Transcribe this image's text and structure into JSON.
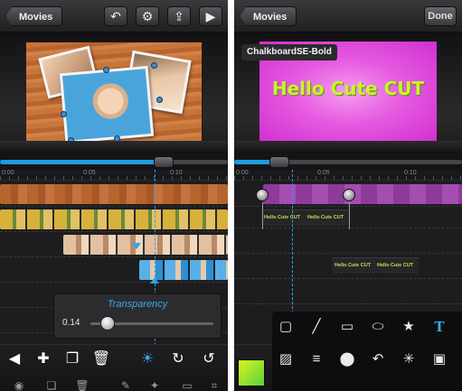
{
  "left": {
    "topbar": {
      "back_label": "Movies"
    },
    "ruler": {
      "t0": "0:00",
      "t1": "0:05",
      "t2": "0:10"
    },
    "popover": {
      "title": "Transparency",
      "value": "0.14",
      "level": 0.14
    },
    "scrubber": {
      "progress": 0.72
    }
  },
  "right": {
    "topbar": {
      "back_label": "Movies",
      "done_label": "Done"
    },
    "font_name": "ChalkboardSE-Bold",
    "preview_text": "Hello Cute CUT",
    "ruler": {
      "t0": "0:00",
      "t1": "0:05",
      "t2": "0:10"
    },
    "text_clips": [
      {
        "a": "Hello Cute CUT",
        "b": "Hello Cute CUT"
      },
      {
        "a": "Hello Cute CUT",
        "b": "Hello Cute CUT"
      }
    ],
    "scrubber": {
      "progress": 0.2
    }
  },
  "colors": {
    "accent": "#3aa8ec",
    "preview_bg": "#e55ae0",
    "text_color": "#c8f52a",
    "wood": "#b8642d"
  }
}
